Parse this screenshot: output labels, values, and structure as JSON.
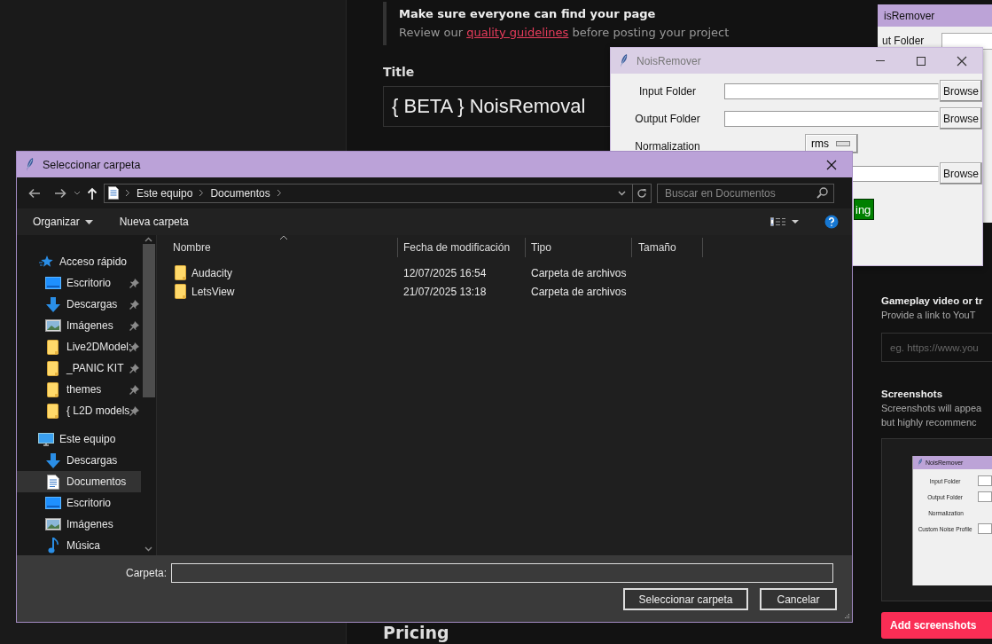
{
  "web_page": {
    "notice": {
      "heading": "Make sure everyone can find your page",
      "text_before": "Review our ",
      "link": "quality guidelines",
      "text_after": " before posting your project"
    },
    "title_label": "Title",
    "title_value": "{ BETA } NoisRemoval",
    "gameplay_heading": "Gameplay video or tr",
    "gameplay_hint": "Provide a link to YouT",
    "gameplay_placeholder": "eg. https://www.you",
    "screenshots_heading": "Screenshots",
    "screenshots_hint": [
      "Screenshots will appea",
      "but highly recommenc"
    ],
    "screenshot_preview": {
      "title": "NoisRemover",
      "labels": [
        "Input Folder",
        "Output Folder",
        "Normalization",
        "Custom Noise Profile"
      ]
    },
    "add_button": "Add screenshots",
    "pricing_heading": "Pricing"
  },
  "back_window": {
    "title": "isRemover",
    "label": "ut Folder"
  },
  "nois_window": {
    "title": "NoisRemover",
    "rows": [
      {
        "kind": "folder",
        "label": "Input Folder",
        "button": "Browse"
      },
      {
        "kind": "folder",
        "label": "Output Folder",
        "button": "Browse"
      },
      {
        "kind": "option",
        "label": "Normalization",
        "value": "rms"
      },
      {
        "kind": "folder",
        "button": "Browse"
      }
    ],
    "start_button": "ing"
  },
  "dialog": {
    "title": "Seleccionar carpeta",
    "breadcrumb": [
      "Este equipo",
      "Documentos"
    ],
    "search_placeholder": "Buscar en Documentos",
    "commands": [
      "Organizar",
      "Nueva carpeta"
    ],
    "nav": [
      {
        "label": "Acceso rápido",
        "kind": "star",
        "selected": false,
        "children": [
          {
            "label": "Escritorio",
            "kind": "desktop",
            "pinned": true,
            "selected": false
          },
          {
            "label": "Descargas",
            "kind": "download",
            "pinned": true,
            "selected": false
          },
          {
            "label": "Imágenes",
            "kind": "pictures",
            "pinned": true,
            "selected": false
          },
          {
            "label": "Live2DModel:",
            "kind": "folder",
            "pinned": true,
            "selected": false
          },
          {
            "label": "_PANIC KIT",
            "kind": "folder",
            "pinned": true,
            "selected": false
          },
          {
            "label": "themes",
            "kind": "folder",
            "pinned": true,
            "selected": false
          },
          {
            "label": "{ L2D models",
            "kind": "folder",
            "pinned": true,
            "selected": false
          }
        ]
      },
      {
        "label": "Este equipo",
        "kind": "pc",
        "selected": false,
        "children": [
          {
            "label": "Descargas",
            "kind": "download",
            "pinned": false,
            "selected": false
          },
          {
            "label": "Documentos",
            "kind": "documents",
            "pinned": false,
            "selected": true
          },
          {
            "label": "Escritorio",
            "kind": "desktop",
            "pinned": false,
            "selected": false
          },
          {
            "label": "Imágenes",
            "kind": "pictures",
            "pinned": false,
            "selected": false
          },
          {
            "label": "Música",
            "kind": "music",
            "pinned": false,
            "selected": false
          }
        ]
      }
    ],
    "columns": [
      "Nombre",
      "Fecha de modificación",
      "Tipo",
      "Tamaño"
    ],
    "rows": [
      {
        "name": "Audacity",
        "modified": "12/07/2025 16:54",
        "type": "Carpeta de archivos",
        "selected": false
      },
      {
        "name": "LetsView",
        "modified": "21/07/2025 13:18",
        "type": "Carpeta de archivos",
        "selected": false
      }
    ],
    "folder_label": "Carpeta:",
    "buttons": [
      "Seleccionar carpeta",
      "Cancelar"
    ]
  }
}
